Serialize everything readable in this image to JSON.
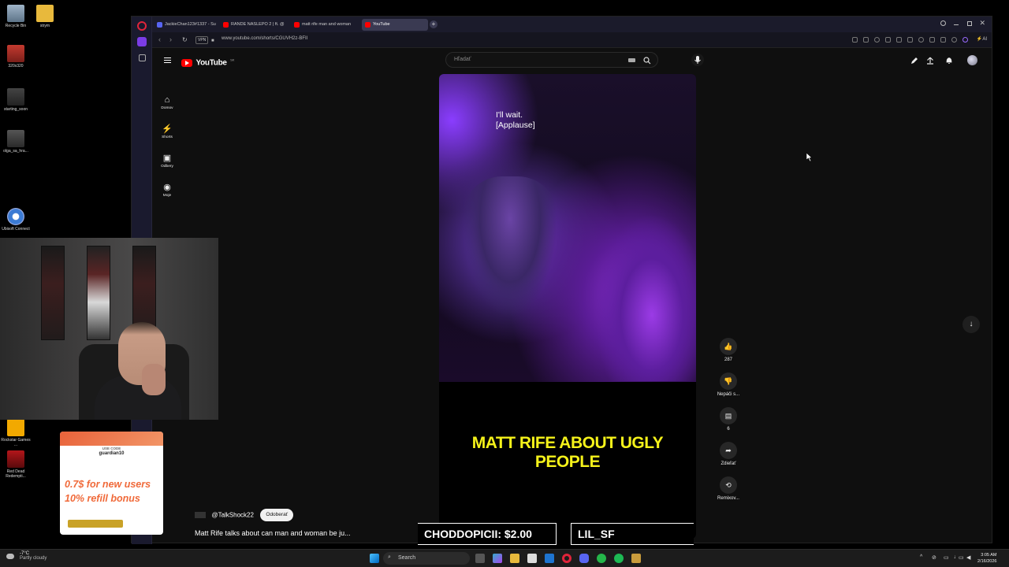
{
  "desktop": {
    "icons": [
      {
        "label": "Recycle Bin"
      },
      {
        "label": "strym"
      },
      {
        "label": "320x320"
      },
      {
        "label": "starting_soon"
      },
      {
        "label": "olga_sa_hra..."
      },
      {
        "label": "Ubisoft Connect"
      },
      {
        "label": "Rockstar Games ..."
      },
      {
        "label": "Red Dead Redempti..."
      }
    ]
  },
  "browser": {
    "tabs": [
      {
        "label": "JackieChan123#1337 - Su",
        "color": "#5865f2"
      },
      {
        "label": "RANDE NASLEPO 2 | ft. @",
        "color": "#ff0000"
      },
      {
        "label": "matt rife man and woman",
        "color": "#ff0000"
      },
      {
        "label": "YouTube",
        "color": "#ff0000"
      }
    ],
    "vpn_label": "VPN",
    "url": "www.youtube.com/shorts/CGUVH2z-BFII"
  },
  "youtube": {
    "logo_text": "YouTube",
    "region": "SK",
    "search_placeholder": "Hľadať",
    "nav": [
      {
        "label": "Domov",
        "icon": "home-icon"
      },
      {
        "label": "Shorts",
        "icon": "shorts-icon"
      },
      {
        "label": "Odbery",
        "icon": "subscriptions-icon"
      },
      {
        "label": "Moje",
        "icon": "you-icon"
      }
    ],
    "short": {
      "caption_line1": "I'll wait.",
      "caption_line2": "[Applause]",
      "headline": "MATT RIFE ABOUT UGLY PEOPLE",
      "channel": "@TalkShock22",
      "subscribe_label": "Odoberať",
      "title": "Matt Rife talks about can man and woman be ju..."
    },
    "actions": {
      "like_count": "287",
      "dislike_label": "Nepáči s...",
      "comment_count": "6",
      "share_label": "Zdieľať",
      "remix_label": "Remixov..."
    }
  },
  "overlay": {
    "promo": {
      "code_label": "USE CODE",
      "code": "guardian10",
      "line1": "0.7$ for new users",
      "line2": "10% refill bonus"
    },
    "ticker": [
      {
        "text": "CHODDOPICII: $2.00"
      },
      {
        "text": "LIL_SF"
      }
    ]
  },
  "taskbar": {
    "weather_temp": "-7°C",
    "weather_desc": "Partly cloudy",
    "search_label": "Search",
    "time": "3:05 AM",
    "date": "2/16/2026"
  }
}
